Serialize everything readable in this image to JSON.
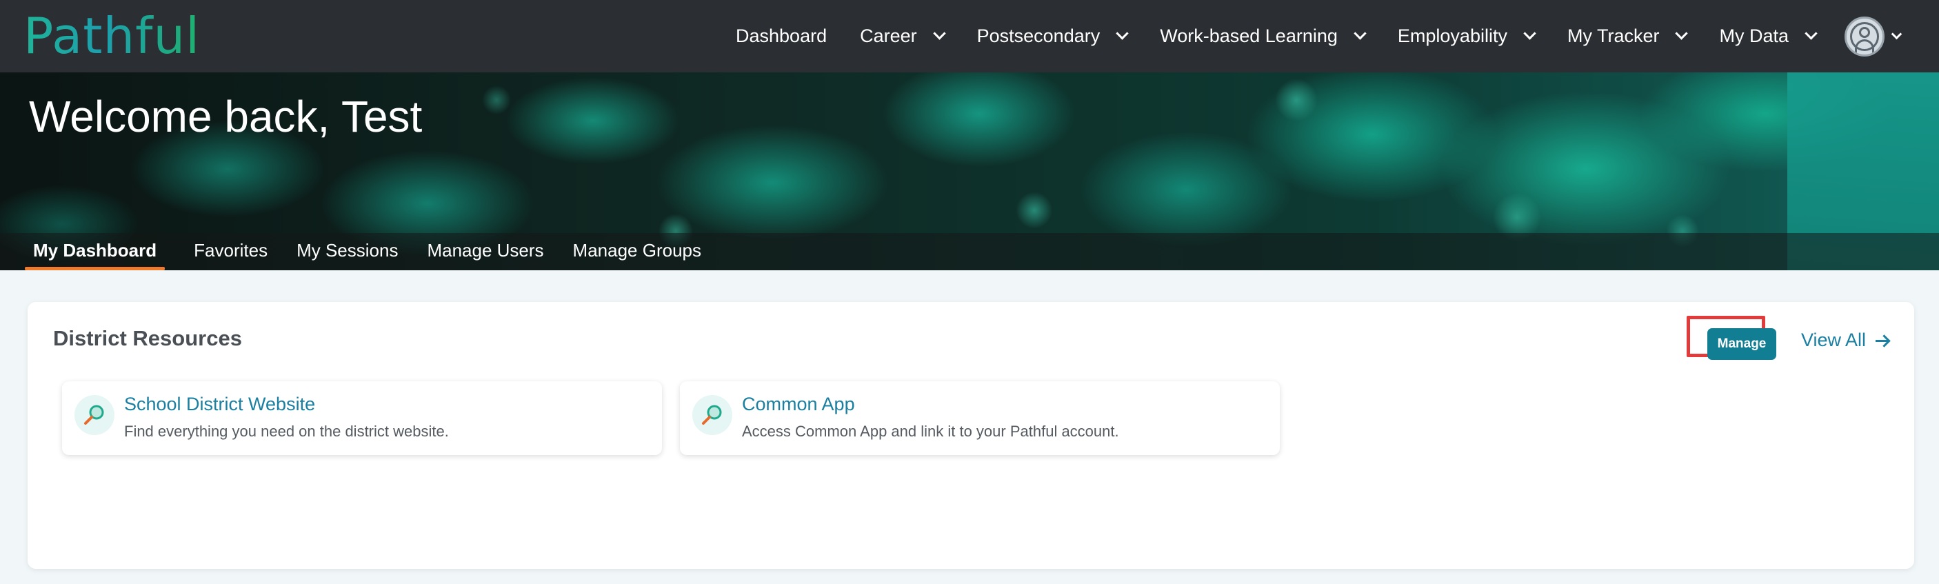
{
  "app": {
    "logo_text": "Pathful",
    "colors": {
      "topbar": "#2b2e33",
      "accent_teal": "#127e94",
      "link": "#1a7fa0",
      "active_tab_underline": "#ee7a2e",
      "highlight_box": "#e23b3b"
    }
  },
  "nav": {
    "items": [
      {
        "label": "Dashboard",
        "has_menu": false
      },
      {
        "label": "Career",
        "has_menu": true
      },
      {
        "label": "Postsecondary",
        "has_menu": true
      },
      {
        "label": "Work-based Learning",
        "has_menu": true
      },
      {
        "label": "Employability",
        "has_menu": true
      },
      {
        "label": "My Tracker",
        "has_menu": true
      },
      {
        "label": "My Data",
        "has_menu": true
      }
    ],
    "avatar_icon": "user-circle-icon"
  },
  "hero": {
    "title": "Welcome back, Test"
  },
  "tabs": [
    {
      "label": "My Dashboard",
      "active": true
    },
    {
      "label": "Favorites",
      "active": false
    },
    {
      "label": "My Sessions",
      "active": false
    },
    {
      "label": "Manage Users",
      "active": false
    },
    {
      "label": "Manage Groups",
      "active": false
    }
  ],
  "district_resources": {
    "title": "District Resources",
    "manage_label": "Manage",
    "view_all_label": "View All",
    "items": [
      {
        "title": "School District Website",
        "description": "Find everything you need on the district website.",
        "icon": "magnifier-icon"
      },
      {
        "title": "Common App",
        "description": "Access Common App and link it to your Pathful account.",
        "icon": "magnifier-icon"
      }
    ]
  }
}
